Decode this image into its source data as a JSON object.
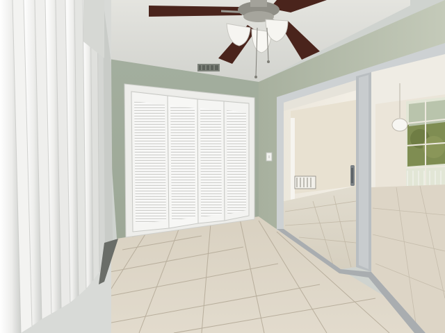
{
  "scene": {
    "colors": {
      "ceiling": "#dcdcd8",
      "wall_left": "#aab4a4",
      "wall_right": "#b8bfae",
      "floor": "#dcd4c4",
      "grout": "#b4ab99",
      "closet_door": "#f4f4f2",
      "frame": "#e6e6e3",
      "slider_frame": "#c9cdcf",
      "blind": "#f1f1ef",
      "fan_blade": "#4a241c",
      "fan_metal": "#9b9a93"
    },
    "icons": {
      "ceiling_fan": "ceiling-fan-icon",
      "air_vent": "vent-icon",
      "light_switch": "light-switch-icon",
      "door_handle": "door-handle-icon"
    }
  }
}
